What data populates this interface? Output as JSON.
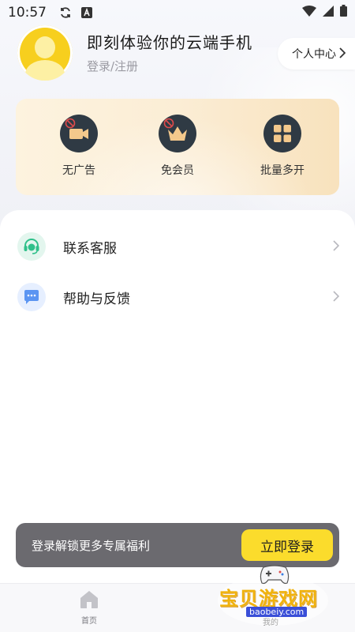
{
  "status_bar": {
    "time": "10:57"
  },
  "profile": {
    "title": "即刻体验你的云端手机",
    "subtitle": "登录/注册",
    "center_label": "个人中心"
  },
  "vip": {
    "items": [
      {
        "label": "无广告",
        "icon": "camera-icon"
      },
      {
        "label": "免会员",
        "icon": "crown-icon"
      },
      {
        "label": "批量多开",
        "icon": "grid-icon"
      }
    ]
  },
  "menu": {
    "items": [
      {
        "label": "联系客服",
        "icon": "headset-icon",
        "color": "#2fc08a"
      },
      {
        "label": "帮助与反馈",
        "icon": "chat-icon",
        "color": "#4a8bf0"
      }
    ]
  },
  "login_banner": {
    "text": "登录解锁更多专属福利",
    "button": "立即登录"
  },
  "nav": {
    "home_label": "首页",
    "mine_label": "我的"
  },
  "watermark": {
    "text": "宝贝游戏网",
    "url": "baobeiy.com"
  },
  "colors": {
    "accent_yellow": "#fbdc2c",
    "avatar_yellow": "#f7cf1e",
    "banner_gray": "#6b6a6f",
    "vip_icon_dark": "#2f3a44"
  }
}
